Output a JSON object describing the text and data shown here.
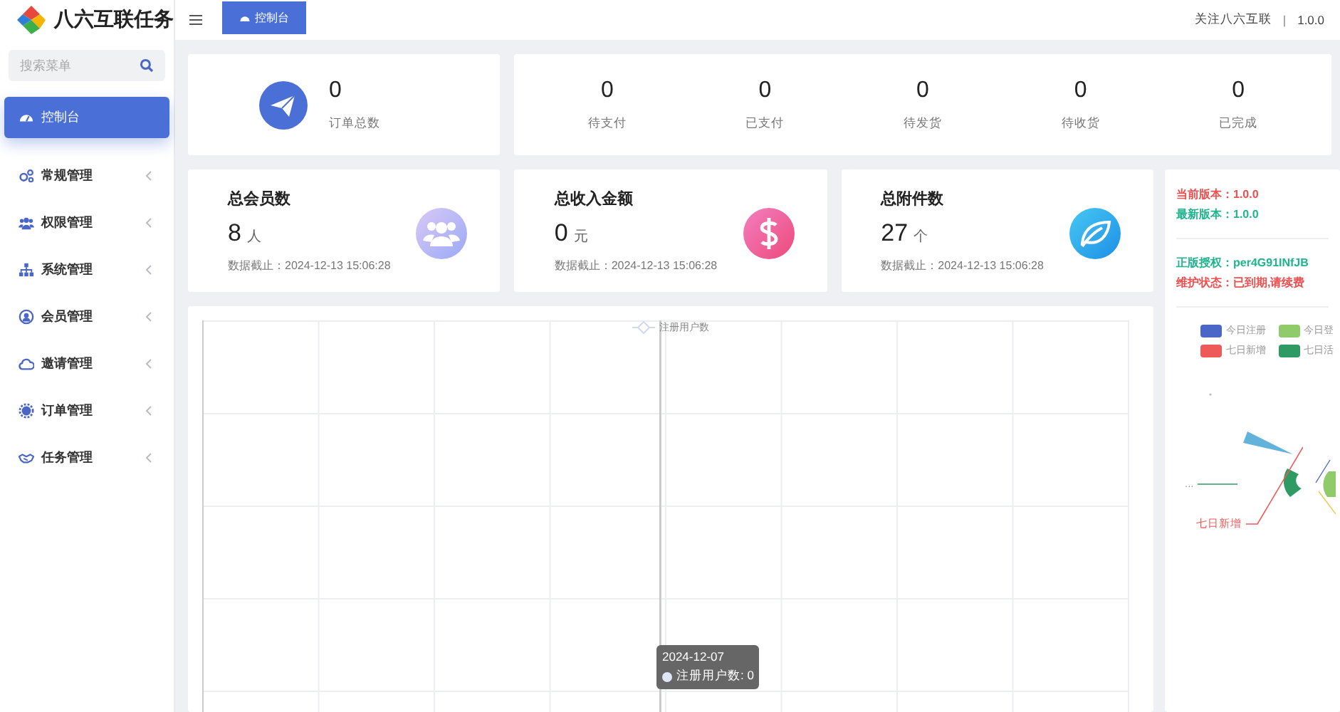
{
  "brand": {
    "title": "八六互联任务"
  },
  "header": {
    "tabs": [
      {
        "label": "控制台",
        "selected": true
      }
    ],
    "links": [
      "关注八六互联",
      "1.0.0"
    ],
    "separator": "|"
  },
  "sidebar": {
    "search": {
      "placeholder": "搜索菜单"
    },
    "items": [
      {
        "label": "控制台",
        "selected": true,
        "expandable": false
      },
      {
        "label": "常规管理",
        "selected": false,
        "expandable": true
      },
      {
        "label": "权限管理",
        "selected": false,
        "expandable": true
      },
      {
        "label": "系统管理",
        "selected": false,
        "expandable": true
      },
      {
        "label": "会员管理",
        "selected": false,
        "expandable": true
      },
      {
        "label": "邀请管理",
        "selected": false,
        "expandable": true
      },
      {
        "label": "订单管理",
        "selected": false,
        "expandable": true
      },
      {
        "label": "任务管理",
        "selected": false,
        "expandable": true
      }
    ]
  },
  "order_summary": {
    "total": {
      "value": "0",
      "label": "订单总数"
    },
    "statuses": [
      {
        "value": "0",
        "label": "待支付"
      },
      {
        "value": "0",
        "label": "已支付"
      },
      {
        "value": "0",
        "label": "待发货"
      },
      {
        "value": "0",
        "label": "待收货"
      },
      {
        "value": "0",
        "label": "已完成"
      }
    ]
  },
  "stats": [
    {
      "kind": "members",
      "title": "总会员数",
      "value": "8",
      "unit": "人",
      "note": "数据截止：2024-12-13 15:06:28"
    },
    {
      "kind": "money",
      "title": "总收入金额",
      "value": "0",
      "unit": "元",
      "note": "数据截止：2024-12-13 15:06:28"
    },
    {
      "kind": "files",
      "title": "总附件数",
      "value": "27",
      "unit": "个",
      "note": "数据截止：2024-12-13 15:06:28"
    }
  ],
  "registration_chart": {
    "legend": "注册用户数",
    "tooltip": {
      "date": "2024-12-07",
      "text": "注册用户数: 0"
    }
  },
  "info_panel": {
    "groups": [
      [
        {
          "label": "当前版本：",
          "value": "1.0.0",
          "color": "#ef4f4f"
        },
        {
          "label": "最新版本：",
          "value": "1.0.0",
          "color": "#1fb58f"
        }
      ],
      [
        {
          "label": "正版授权：",
          "value": "per4G91INfJB",
          "color": "#1fb58f"
        },
        {
          "label": "维护状态：",
          "value": "已到期,请续费",
          "color": "#ef4f4f"
        }
      ]
    ]
  },
  "activity_chart": {
    "legend": [
      {
        "label": "今日注册",
        "color": "#4a67c8"
      },
      {
        "label": "今日登",
        "color": "#8fcb6a"
      },
      {
        "label": "七日新增",
        "color": "#ee5a5a"
      },
      {
        "label": "七日活",
        "color": "#2f9a63"
      }
    ],
    "labels": [
      {
        "kind": "plain",
        "text": "..."
      },
      {
        "kind": "series",
        "text": "七日新增"
      }
    ]
  }
}
